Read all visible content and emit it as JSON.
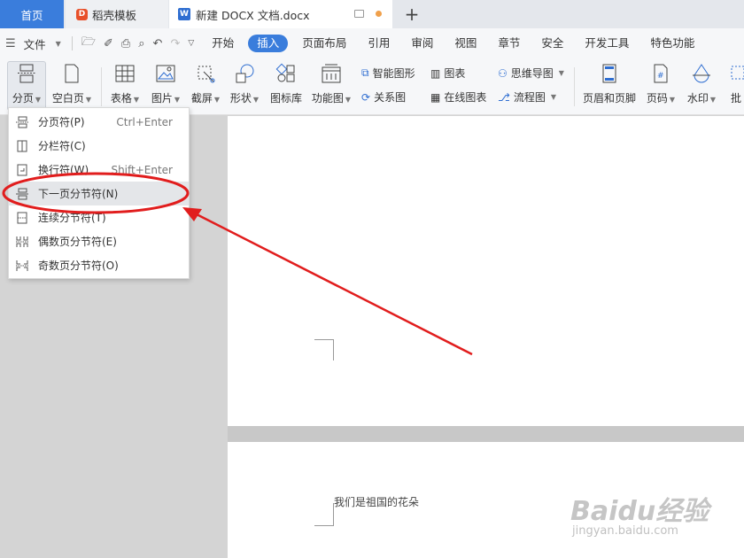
{
  "tabs": {
    "home": "首页",
    "daoke": "稻壳模板",
    "doc": "新建 DOCX 文档.docx",
    "plus": "+"
  },
  "menu": {
    "file": "文件",
    "items": [
      "开始",
      "插入",
      "页面布局",
      "引用",
      "审阅",
      "视图",
      "章节",
      "安全",
      "开发工具",
      "特色功能"
    ],
    "active": "插入"
  },
  "ribbon": {
    "page_break": "分页",
    "blank_page": "空白页",
    "table": "表格",
    "picture": "图片",
    "screenshot": "截屏",
    "shape": "形状",
    "icon_lib": "图标库",
    "func_chart": "功能图",
    "smart_shape": "智能图形",
    "chart": "图表",
    "mind_map": "思维导图",
    "relation": "关系图",
    "online_chart": "在线图表",
    "flowchart": "流程图",
    "header_footer": "页眉和页脚",
    "page_num": "页码",
    "watermark": "水印",
    "comment": "批"
  },
  "dropdown": {
    "items": [
      {
        "label": "分页符(P)",
        "shortcut": "Ctrl+Enter"
      },
      {
        "label": "分栏符(C)",
        "shortcut": ""
      },
      {
        "label": "换行符(W)",
        "shortcut": "Shift+Enter"
      },
      {
        "label": "下一页分节符(N)",
        "shortcut": ""
      },
      {
        "label": "连续分节符(T)",
        "shortcut": ""
      },
      {
        "label": "偶数页分节符(E)",
        "shortcut": ""
      },
      {
        "label": "奇数页分节符(O)",
        "shortcut": ""
      }
    ],
    "highlighted": "下一页分节符(N)"
  },
  "document": {
    "body_text": "我们是祖国的花朵"
  },
  "watermark": {
    "logo": "Baidu经验",
    "url": "jingyan.baidu.com"
  },
  "colors": {
    "accent": "#3a7ddc",
    "annotation": "#e11d1d"
  }
}
